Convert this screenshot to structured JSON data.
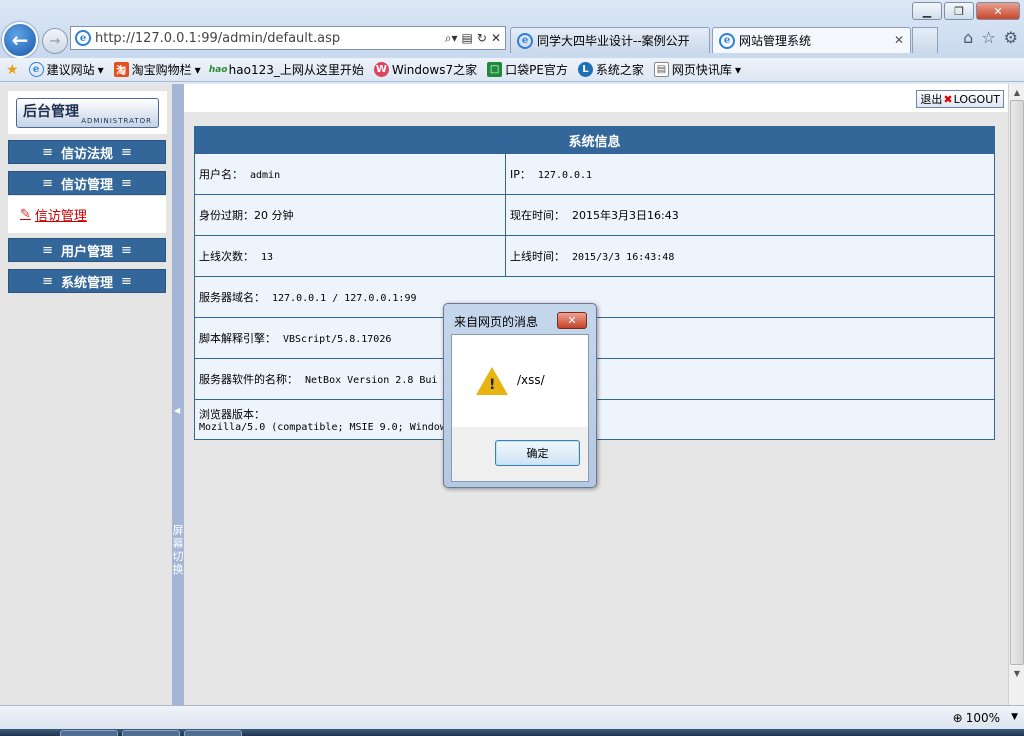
{
  "browser": {
    "address": "http://127.0.0.1:99/admin/default.asp",
    "tabs": [
      {
        "label": "同学大四毕业设计--案例公开",
        "active": false
      },
      {
        "label": "网站管理系统",
        "active": true
      }
    ],
    "favorites": [
      {
        "label": "建议网站",
        "icon": "ie-icon",
        "dropdown": true
      },
      {
        "label": "淘宝购物栏",
        "icon": "taobao-icon",
        "dropdown": true
      },
      {
        "label": "hao123_上网从这里开始",
        "icon": "hao123-icon",
        "dropdown": false
      },
      {
        "label": "Windows7之家",
        "icon": "windows7-icon",
        "dropdown": false
      },
      {
        "label": "口袋PE官方",
        "icon": "pe-icon",
        "dropdown": false
      },
      {
        "label": "系统之家",
        "icon": "xitong-icon",
        "dropdown": false
      },
      {
        "label": "网页快讯库",
        "icon": "feed-icon",
        "dropdown": true
      }
    ],
    "zoom": "100%"
  },
  "admin": {
    "logo_cn": "后台管理",
    "logo_en": "ADMINISTRATOR",
    "logout_cn": "退出",
    "logout_en": "LOGOUT",
    "menu": [
      {
        "label": "信访法规"
      },
      {
        "label": "信访管理",
        "expanded": true,
        "sub": [
          "信访管理"
        ]
      },
      {
        "label": "用户管理"
      },
      {
        "label": "系统管理"
      }
    ],
    "splitter_text": "屏幕切换"
  },
  "info": {
    "title": "系统信息",
    "username_label": "用户名：",
    "username": "admin",
    "ip_label": "IP：",
    "ip": "127.0.0.1",
    "expire_label": "身份过期：",
    "expire": "20 分钟",
    "now_label": "现在时间：",
    "now": "2015年3月3日16:43",
    "logins_label": "上线次数：",
    "logins": "13",
    "online_label": "上线时间：",
    "online": "2015/3/3 16:43:48",
    "domain_label": "服务器域名：",
    "domain": "127.0.0.1 / 127.0.0.1:99",
    "engine_label": "脚本解释引擎：",
    "engine": "VBScript/5.8.17026",
    "software_label": "服务器软件的名称：",
    "software": "NetBox Version 2.8 Bui",
    "browser_label": "浏览器版本：",
    "browser": "Mozilla/5.0 (compatible; MSIE 9.0; Window"
  },
  "dialog": {
    "title": "来自网页的消息",
    "message": "/xss/",
    "ok": "确定"
  },
  "colors": {
    "menu_blue": "#336699",
    "splitter": "#a4b5d6",
    "info_bg": "#eef4fb"
  }
}
